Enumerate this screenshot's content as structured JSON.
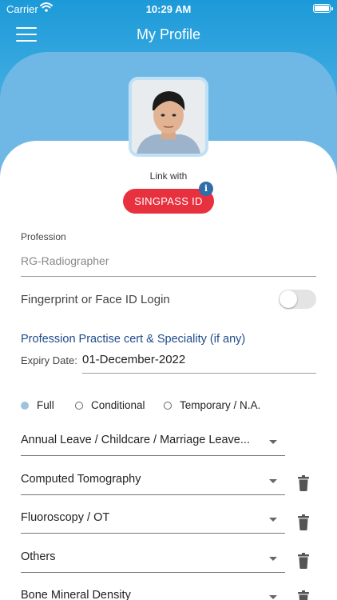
{
  "status_bar": {
    "carrier": "Carrier",
    "time": "10:29 AM"
  },
  "header": {
    "title": "My Profile"
  },
  "link": {
    "label": "Link with",
    "button": "SINGPASS ID",
    "info_glyph": "i"
  },
  "profession": {
    "label": "Profession",
    "value": "RG-Radiographer"
  },
  "biometric": {
    "label": "Fingerprint or Face ID Login",
    "enabled": false
  },
  "certification": {
    "title": "Profession Practise cert & Speciality (if any)",
    "expiry_label": "Expiry Date:",
    "expiry_value": "01-December-2022"
  },
  "cert_type": {
    "selected": "Full",
    "options": [
      "Full",
      "Conditional",
      "Temporary / N.A."
    ]
  },
  "dropdowns": [
    {
      "text": "Annual Leave / Childcare / Marriage Leave...",
      "deletable": false
    },
    {
      "text": "Computed Tomography",
      "deletable": true
    },
    {
      "text": "Fluoroscopy / OT",
      "deletable": true
    },
    {
      "text": "Others",
      "deletable": true
    },
    {
      "text": "Bone Mineral Density",
      "deletable": true
    }
  ],
  "colors": {
    "header": "#1c9ad8",
    "singpass": "#e8313f",
    "section_title": "#1f4b8a",
    "radio_selected": "#9ec3db"
  },
  "icons": [
    "menu-icon",
    "wifi-icon",
    "battery-icon",
    "info-icon",
    "caret-down-icon",
    "trash-icon"
  ]
}
